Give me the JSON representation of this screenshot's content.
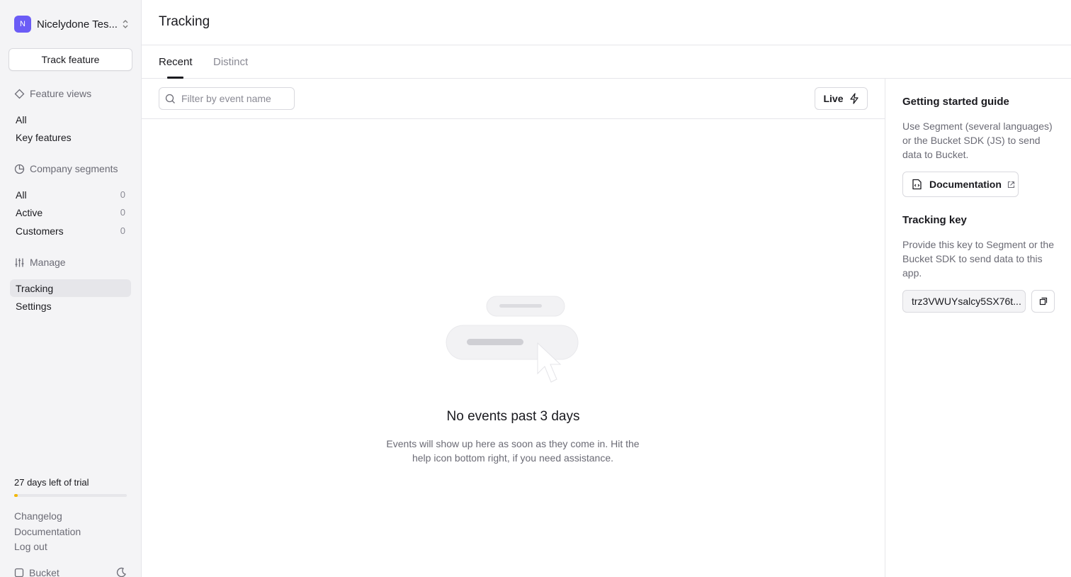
{
  "sidebar": {
    "org": {
      "initial": "N",
      "name": "Nicelydone Tes..."
    },
    "track_feature_label": "Track feature",
    "feature_views": {
      "heading": "Feature views",
      "items": [
        {
          "label": "All"
        },
        {
          "label": "Key features"
        }
      ]
    },
    "company_segments": {
      "heading": "Company segments",
      "items": [
        {
          "label": "All",
          "count": "0"
        },
        {
          "label": "Active",
          "count": "0"
        },
        {
          "label": "Customers",
          "count": "0"
        }
      ]
    },
    "manage": {
      "heading": "Manage",
      "items": [
        {
          "label": "Tracking",
          "active": true
        },
        {
          "label": "Settings"
        }
      ]
    },
    "trial": {
      "text": "27 days left of trial",
      "progress": 0.03,
      "color": "#f2b705"
    },
    "footer_links": [
      {
        "label": "Changelog"
      },
      {
        "label": "Documentation"
      },
      {
        "label": "Log out"
      }
    ],
    "brand": "Bucket"
  },
  "header": {
    "title": "Tracking"
  },
  "tabs": [
    {
      "label": "Recent",
      "active": true
    },
    {
      "label": "Distinct",
      "active": false
    }
  ],
  "filter": {
    "placeholder": "Filter by event name",
    "value": ""
  },
  "live_label": "Live",
  "empty_state": {
    "title": "No events past 3 days",
    "description": "Events will show up here as soon as they come in. Hit the help icon bottom right, if you need assistance."
  },
  "right_panel": {
    "guide": {
      "title": "Getting started guide",
      "text": "Use Segment (several languages) or the Bucket SDK (JS) to send data to Bucket.",
      "doc_button": "Documentation"
    },
    "tracking_key": {
      "title": "Tracking key",
      "text": "Provide this key to Segment or the Bucket SDK to send data to this app.",
      "value": "trz3VWUYsalcy5SX76t..."
    }
  },
  "colors": {
    "accent": "#6b5cf6",
    "trial": "#f2b705"
  }
}
